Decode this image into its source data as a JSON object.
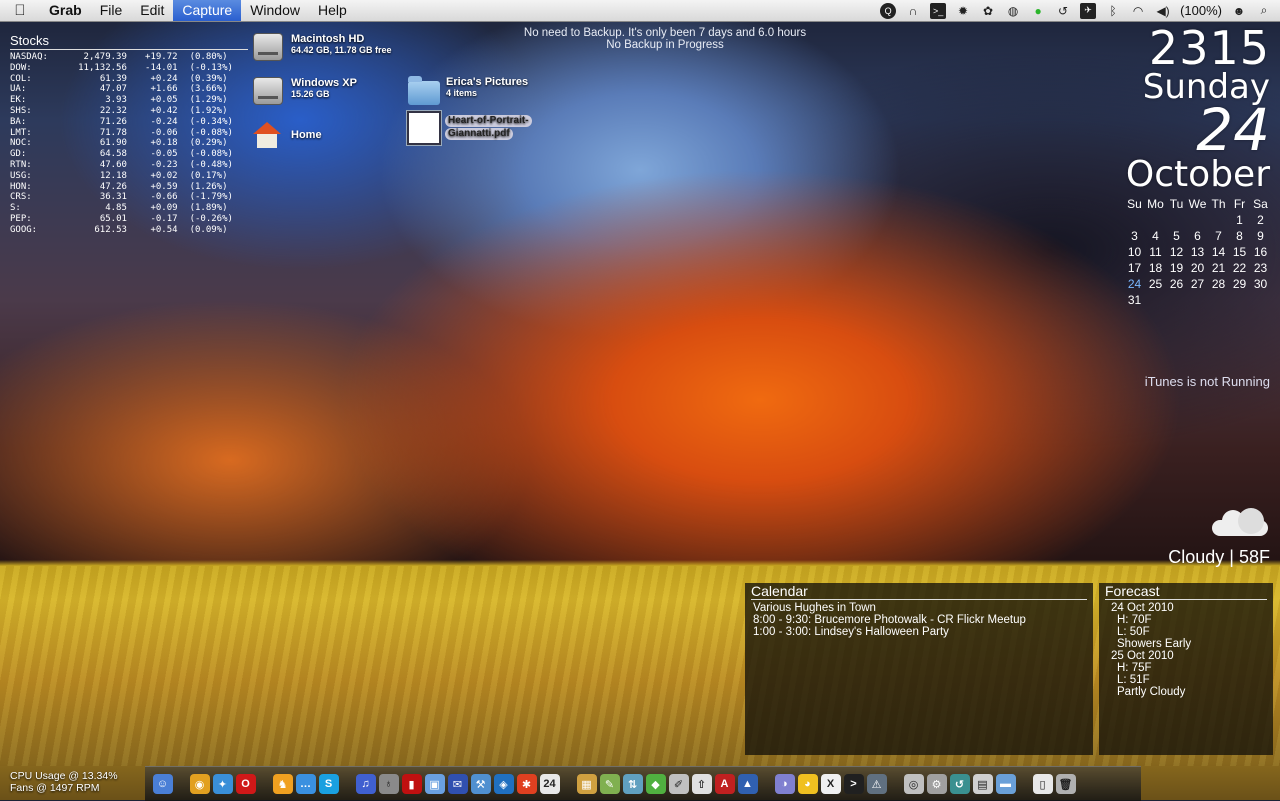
{
  "menubar": {
    "items": [
      {
        "label": "Grab",
        "app": true,
        "selected": false
      },
      {
        "label": "File",
        "app": false,
        "selected": false
      },
      {
        "label": "Edit",
        "app": false,
        "selected": false
      },
      {
        "label": "Capture",
        "app": false,
        "selected": true
      },
      {
        "label": "Window",
        "app": false,
        "selected": false
      },
      {
        "label": "Help",
        "app": false,
        "selected": false
      }
    ],
    "status_icons": [
      "quicksilver-icon",
      "headphones-icon",
      "terminal-icon",
      "gear-icon",
      "paw-icon",
      "globe-icon",
      "green-status-icon",
      "time-machine-icon",
      "airplane-icon",
      "bluetooth-icon",
      "wifi-icon",
      "volume-icon"
    ],
    "battery": "(100%)"
  },
  "stocks": {
    "title": "Stocks",
    "rows": [
      [
        "NASDAQ:",
        "2,479.39",
        "+19.72",
        "(0.80%)"
      ],
      [
        "DOW:",
        "11,132.56",
        "-14.01",
        "(-0.13%)"
      ],
      [
        "COL:",
        "61.39",
        "+0.24",
        "(0.39%)"
      ],
      [
        "UA:",
        "47.07",
        "+1.66",
        "(3.66%)"
      ],
      [
        "EK:",
        "3.93",
        "+0.05",
        "(1.29%)"
      ],
      [
        "SHS:",
        "22.32",
        "+0.42",
        "(1.92%)"
      ],
      [
        "BA:",
        "71.26",
        "-0.24",
        "(-0.34%)"
      ],
      [
        "LMT:",
        "71.78",
        "-0.06",
        "(-0.08%)"
      ],
      [
        "NOC:",
        "61.90",
        "+0.18",
        "(0.29%)"
      ],
      [
        "GD:",
        "64.58",
        "-0.05",
        "(-0.08%)"
      ],
      [
        "RTN:",
        "47.60",
        "-0.23",
        "(-0.48%)"
      ],
      [
        "USG:",
        "12.18",
        "+0.02",
        "(0.17%)"
      ],
      [
        "HON:",
        "47.26",
        "+0.59",
        "(1.26%)"
      ],
      [
        "CRS:",
        "36.31",
        "-0.66",
        "(-1.79%)"
      ],
      [
        "S:",
        "4.85",
        "+0.09",
        "(1.89%)"
      ],
      [
        "PEP:",
        "65.01",
        "-0.17",
        "(-0.26%)"
      ],
      [
        "GOOG:",
        "612.53",
        "+0.54",
        "(0.09%)"
      ]
    ]
  },
  "desktop": {
    "macintosh_hd": {
      "name": "Macintosh HD",
      "sub": "64.42 GB, 11.78 GB free"
    },
    "windows_xp": {
      "name": "Windows XP",
      "sub": "15.26 GB"
    },
    "home": {
      "name": "Home"
    },
    "ericas_pictures": {
      "name": "Erica's Pictures",
      "sub": "4 items"
    },
    "pdf": {
      "line1": "Heart-of-Portrait-",
      "line2": "Giannatti.pdf"
    }
  },
  "backup": {
    "line1": "No need to Backup. It's only been 7 days and 6.0 hours",
    "line2": "No Backup in Progress"
  },
  "clock": {
    "time": "2315",
    "weekday": "Sunday",
    "day": "24",
    "month": "October"
  },
  "calendar_grid": {
    "headers": [
      "Su",
      "Mo",
      "Tu",
      "We",
      "Th",
      "Fr",
      "Sa"
    ],
    "days": [
      "",
      "",
      "",
      "",
      "",
      "1",
      "2",
      "3",
      "4",
      "5",
      "6",
      "7",
      "8",
      "9",
      "10",
      "11",
      "12",
      "13",
      "14",
      "15",
      "16",
      "17",
      "18",
      "19",
      "20",
      "21",
      "22",
      "23",
      "24",
      "25",
      "26",
      "27",
      "28",
      "29",
      "30",
      "31"
    ],
    "today": "24"
  },
  "itunes": "iTunes is not Running",
  "weather": {
    "text": "Cloudy | 58F",
    "icon": "cloud-icon"
  },
  "calendar_panel": {
    "title": "Calendar",
    "events": [
      "Various Hughes in Town",
      "8:00 - 9:30: Brucemore Photowalk - CR Flickr Meetup",
      "1:00 - 3:00: Lindsey's Halloween Party"
    ]
  },
  "forecast_panel": {
    "title": "Forecast",
    "lines": [
      "24 Oct 2010",
      "H: 70F",
      "L: 50F",
      "Showers Early",
      "25 Oct 2010",
      "H: 75F",
      "L: 51F",
      "Partly Cloudy"
    ]
  },
  "system": {
    "cpu": "CPU Usage @ 13.34%",
    "fans": "Fans @ 1497 RPM"
  },
  "dock": {
    "icons": [
      {
        "name": "finder-icon",
        "color": "#4a7fd6",
        "glyph": "☺"
      },
      {
        "name": "chrome-icon",
        "color": "#e2a020",
        "glyph": "◉"
      },
      {
        "name": "safari-icon",
        "color": "#3a8fd8",
        "glyph": "✦"
      },
      {
        "name": "opera-icon",
        "color": "#d01818",
        "glyph": "O"
      },
      {
        "name": "adium-icon",
        "color": "#f0a020",
        "glyph": "♞"
      },
      {
        "name": "ichat-icon",
        "color": "#3a90e0",
        "glyph": "…"
      },
      {
        "name": "skype-icon",
        "color": "#1aa0e0",
        "glyph": "S"
      },
      {
        "name": "itunes-icon",
        "color": "#4060d0",
        "glyph": "♫"
      },
      {
        "name": "instruments-icon",
        "color": "#8a8a8a",
        "glyph": "♁"
      },
      {
        "name": "photo-booth-icon",
        "color": "#c01010",
        "glyph": "▮"
      },
      {
        "name": "iphoto-icon",
        "color": "#6aa0e0",
        "glyph": "▣"
      },
      {
        "name": "mail-icon",
        "color": "#3050b0",
        "glyph": "✉"
      },
      {
        "name": "xcode-icon",
        "color": "#5090d0",
        "glyph": "⚒"
      },
      {
        "name": "network-icon",
        "color": "#2070c0",
        "glyph": "◈"
      },
      {
        "name": "ruby-icon",
        "color": "#e04020",
        "glyph": "✱"
      },
      {
        "name": "ical-icon",
        "color": "#e8e8e8",
        "glyph": "24"
      },
      {
        "name": "preview-icon",
        "color": "#d0a040",
        "glyph": "▦"
      },
      {
        "name": "sketch-icon",
        "color": "#80b050",
        "glyph": "✎"
      },
      {
        "name": "transmit-icon",
        "color": "#60a0c0",
        "glyph": "⇅"
      },
      {
        "name": "coda-icon",
        "color": "#50b040",
        "glyph": "◆"
      },
      {
        "name": "pencil-icon",
        "color": "#c0c0c0",
        "glyph": "✐"
      },
      {
        "name": "upload-icon",
        "color": "#e0e0e0",
        "glyph": "⇧"
      },
      {
        "name": "acrobat-icon",
        "color": "#c02020",
        "glyph": "A"
      },
      {
        "name": "keynote-icon",
        "color": "#3060b0",
        "glyph": "▲"
      },
      {
        "name": "dashboard-icon",
        "color": "#8080d0",
        "glyph": "◑"
      },
      {
        "name": "cyberduck-icon",
        "color": "#f0c020",
        "glyph": "◕"
      },
      {
        "name": "x11-icon",
        "color": "#f0f0f0",
        "glyph": "X"
      },
      {
        "name": "terminal-icon",
        "color": "#202020",
        "glyph": ">"
      },
      {
        "name": "console-icon",
        "color": "#607080",
        "glyph": "⚠"
      },
      {
        "name": "disk-utility-icon",
        "color": "#c0c0c0",
        "glyph": "◎"
      },
      {
        "name": "utility-icon",
        "color": "#a0a0a0",
        "glyph": "⚙"
      },
      {
        "name": "timemachine-icon",
        "color": "#3a9090",
        "glyph": "↺"
      },
      {
        "name": "screenshot-icon",
        "color": "#d0d0d0",
        "glyph": "▤"
      },
      {
        "name": "documents-icon",
        "color": "#6aa0d8",
        "glyph": "▬"
      },
      {
        "name": "downloads-icon",
        "color": "#e8e8e8",
        "glyph": "▯"
      },
      {
        "name": "trash-icon",
        "color": "#b0b0b0",
        "glyph": "🗑"
      }
    ]
  }
}
